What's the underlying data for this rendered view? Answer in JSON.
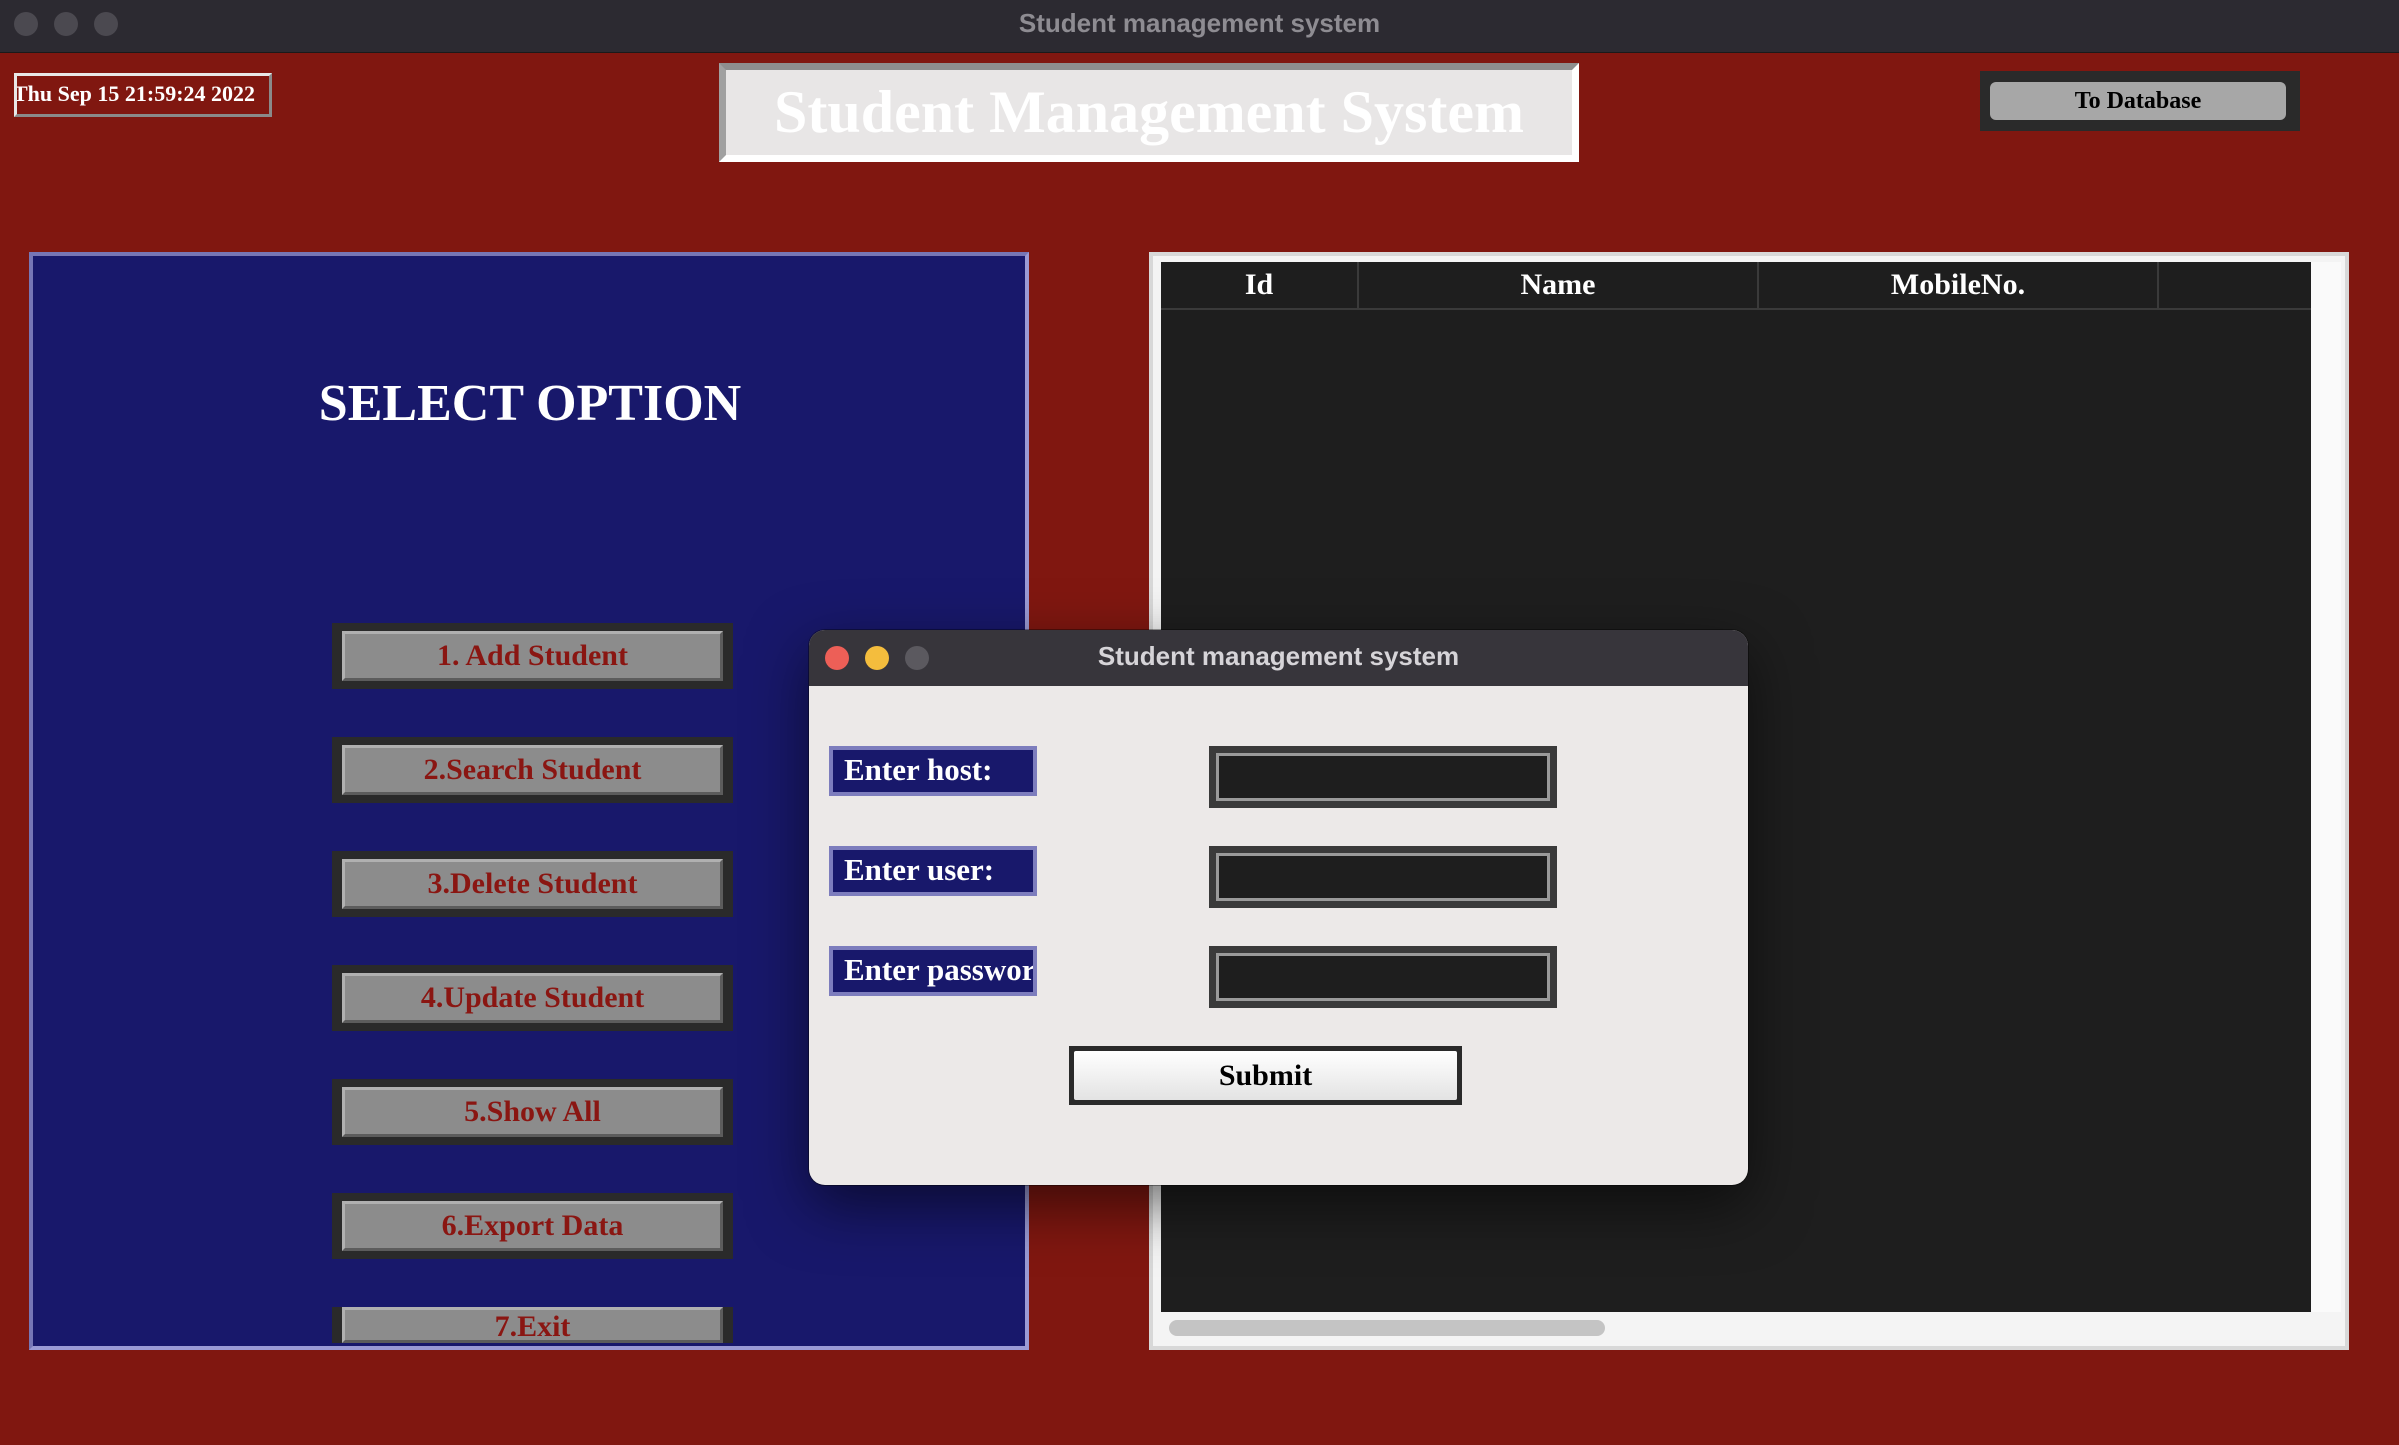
{
  "window": {
    "title": "Student management system"
  },
  "header": {
    "clock_text": "Thu Sep 15 21:59:24 2022",
    "app_title": "Student Management System",
    "to_database_label": "To Database"
  },
  "menu": {
    "title": "SELECT OPTION",
    "options": [
      "1. Add Student",
      "2.Search Student",
      "3.Delete Student",
      "4.Update Student",
      "5.Show All",
      "6.Export Data",
      "7.Exit"
    ]
  },
  "table": {
    "columns": [
      "Id",
      "Name",
      "MobileNo."
    ],
    "rows": []
  },
  "dialog": {
    "title": "Student management system",
    "fields": [
      {
        "label": "Enter host:",
        "value": ""
      },
      {
        "label": "Enter user:",
        "value": ""
      },
      {
        "label": "Enter password:",
        "value": ""
      }
    ],
    "submit_label": "Submit"
  },
  "colors": {
    "window_background": "#801710",
    "panel_background": "#18186b",
    "button_text": "#8a1612",
    "table_background": "#1e1e1e",
    "dialog_background": "#ece9e8"
  }
}
